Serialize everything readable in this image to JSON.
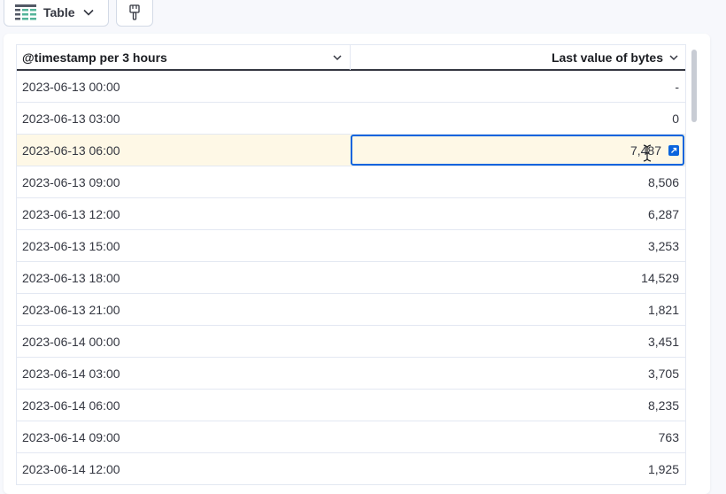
{
  "toolbar": {
    "viz_type_label": "Table"
  },
  "table": {
    "columns": [
      "@timestamp per 3 hours",
      "Last value of bytes"
    ],
    "rows": [
      {
        "timestamp": "2023-06-13 00:00",
        "bytes": "-"
      },
      {
        "timestamp": "2023-06-13 03:00",
        "bytes": "0"
      },
      {
        "timestamp": "2023-06-13 06:00",
        "bytes": "7,487"
      },
      {
        "timestamp": "2023-06-13 09:00",
        "bytes": "8,506"
      },
      {
        "timestamp": "2023-06-13 12:00",
        "bytes": "6,287"
      },
      {
        "timestamp": "2023-06-13 15:00",
        "bytes": "3,253"
      },
      {
        "timestamp": "2023-06-13 18:00",
        "bytes": "14,529"
      },
      {
        "timestamp": "2023-06-13 21:00",
        "bytes": "1,821"
      },
      {
        "timestamp": "2023-06-14 00:00",
        "bytes": "3,451"
      },
      {
        "timestamp": "2023-06-14 03:00",
        "bytes": "3,705"
      },
      {
        "timestamp": "2023-06-14 06:00",
        "bytes": "8,235"
      },
      {
        "timestamp": "2023-06-14 09:00",
        "bytes": "763"
      },
      {
        "timestamp": "2023-06-14 12:00",
        "bytes": "1,925"
      }
    ],
    "highlighted_row": 2
  },
  "colors": {
    "accent": "#0b64dd",
    "highlight_row": "#fef8e6",
    "border": "#e3e8f2",
    "text": "#343741"
  },
  "icons": {
    "viz_type": "table-grid-icon",
    "viz_dropdown": "chevron-down-icon",
    "palette": "paintbrush-icon",
    "column_sort": "chevron-down-icon",
    "cell_expand": "expand-cell-icon",
    "cursor": "text-cursor-icon"
  }
}
